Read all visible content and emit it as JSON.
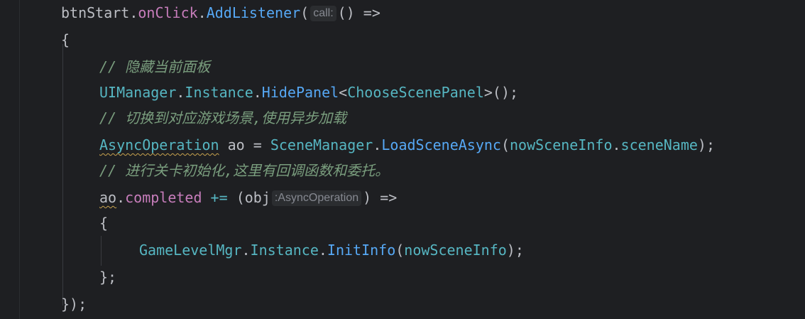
{
  "code": {
    "line1": {
      "receiver": "btnStart",
      "dot1": ".",
      "member": "onClick",
      "dot2": ".",
      "method": "AddListener",
      "open": "(",
      "hint": "call:",
      "lambda": "() =>"
    },
    "line2": {
      "brace": "{"
    },
    "line3": {
      "comment": "// 隐藏当前面板"
    },
    "line4": {
      "cls": "UIManager",
      "dot1": ".",
      "prop": "Instance",
      "dot2": ".",
      "method": "HidePanel",
      "lt": "<",
      "generic": "ChooseScenePanel",
      "tail": ">();"
    },
    "line5": {
      "comment": "// 切换到对应游戏场景,使用异步加载"
    },
    "line6": {
      "type": "AsyncOperation",
      "var": " ao = ",
      "cls": "SceneManager",
      "dot": ".",
      "method": "LoadSceneAsync",
      "open": "(",
      "arg": "nowSceneInfo",
      "dot2": ".",
      "field": "sceneName",
      "close": ");"
    },
    "line7": {
      "comment": "// 进行关卡初始化,这里有回调函数和委托。"
    },
    "line8": {
      "var": "ao",
      "dot": ".",
      "event": "completed",
      "op": " += ",
      "open": "(",
      "param": "obj",
      "hint": ":AsyncOperation",
      "close": ")",
      "arrow": " =>"
    },
    "line9": {
      "brace": "{"
    },
    "line10": {
      "cls": "GameLevelMgr",
      "dot1": ".",
      "prop": "Instance",
      "dot2": ".",
      "method": "InitInfo",
      "open": "(",
      "arg": "nowSceneInfo",
      "close": ");"
    },
    "line11": {
      "brace": "};"
    },
    "line12": {
      "brace": "});"
    }
  },
  "colors": {
    "background": "#1e1f22",
    "method": "#56a8f5",
    "field": "#c77dbb",
    "comment": "#7a9e7e",
    "type": "#56b6c2",
    "text": "#bcbec4"
  }
}
